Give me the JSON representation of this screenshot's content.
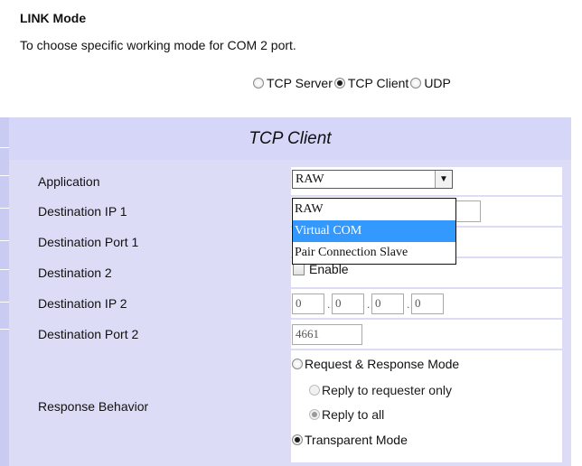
{
  "header": {
    "title": "LINK Mode",
    "description": "To choose specific working mode for COM 2 port."
  },
  "link_modes": [
    {
      "label": "TCP Server",
      "selected": false
    },
    {
      "label": "TCP Client",
      "selected": true
    },
    {
      "label": "UDP",
      "selected": false
    }
  ],
  "panel": {
    "title": "TCP Client",
    "rows": [
      {
        "label": "Application"
      },
      {
        "label": "Destination IP 1"
      },
      {
        "label": "Destination Port 1"
      },
      {
        "label": "Destination 2"
      },
      {
        "label": "Destination IP 2"
      },
      {
        "label": "Destination Port 2"
      },
      {
        "label": "Response Behavior"
      }
    ]
  },
  "application": {
    "selected": "RAW",
    "options": [
      "RAW",
      "Virtual COM",
      "Pair Connection Slave"
    ],
    "highlighted": "Virtual COM"
  },
  "destination2": {
    "checkbox_label": "Enable",
    "checked": false
  },
  "destination_ip2": {
    "octets": [
      "0",
      "0",
      "0",
      "0"
    ]
  },
  "destination_port2": {
    "value": "4661"
  },
  "response_behavior": {
    "options": [
      {
        "label": "Request & Response Mode",
        "selected": false,
        "enabled": true
      },
      {
        "label": "Reply to requester only",
        "selected": false,
        "enabled": false
      },
      {
        "label": "Reply to all",
        "selected": true,
        "enabled": false
      },
      {
        "label": "Transparent Mode",
        "selected": true,
        "enabled": true
      }
    ]
  },
  "colors": {
    "panel_bg": "#dcdcf7",
    "title_bg": "#d6d6f8",
    "dropdown_highlight": "#3399ff"
  }
}
